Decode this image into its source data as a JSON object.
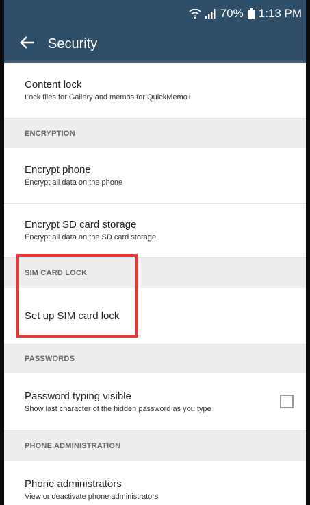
{
  "status_bar": {
    "battery": "70%",
    "time": "1:13 PM"
  },
  "app_bar": {
    "title": "Security"
  },
  "items": {
    "content_lock": {
      "title": "Content lock",
      "subtitle": "Lock files for Gallery and memos for QuickMemo+"
    },
    "encryption_header": "ENCRYPTION",
    "encrypt_phone": {
      "title": "Encrypt phone",
      "subtitle": "Encrypt all data on the phone"
    },
    "encrypt_sd": {
      "title": "Encrypt SD card storage",
      "subtitle": "Encrypt all data on the SD card storage"
    },
    "sim_header": "SIM CARD LOCK",
    "sim_lock": {
      "title": "Set up SIM card lock"
    },
    "passwords_header": "PASSWORDS",
    "password_visible": {
      "title": "Password typing visible",
      "subtitle": "Show last character of the hidden password as you type",
      "checked": false
    },
    "admin_header": "PHONE ADMINISTRATION",
    "phone_admins": {
      "title": "Phone administrators",
      "subtitle": "View or deactivate phone administrators"
    }
  },
  "colors": {
    "app_bar": "#2f4e68",
    "highlight": "#e53935",
    "section_header_bg": "#eeeeee"
  }
}
